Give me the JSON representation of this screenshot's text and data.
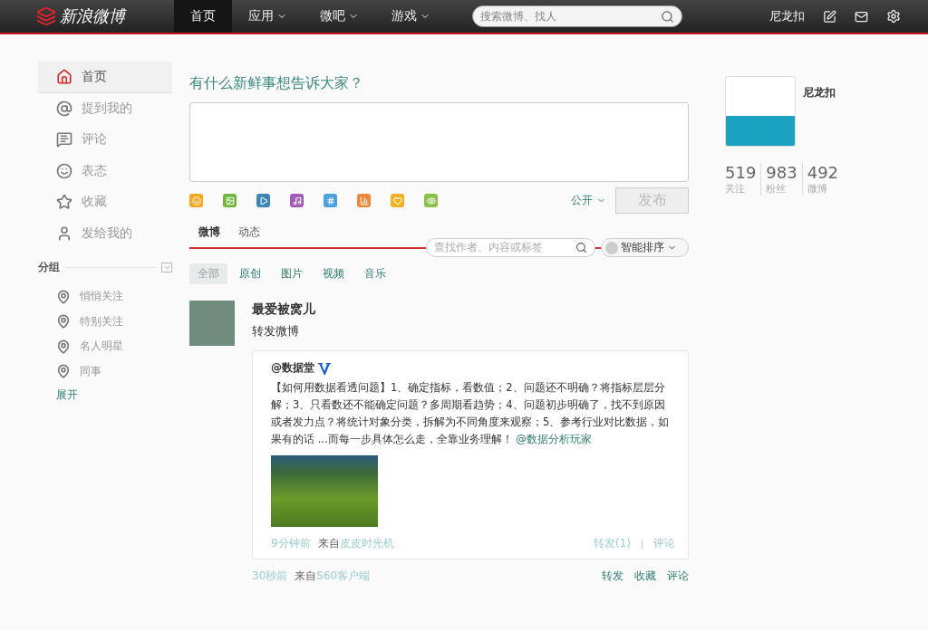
{
  "topbar": {
    "logo": "新浪微博",
    "tabs": [
      {
        "label": "首页",
        "selected": true,
        "dropdown": false
      },
      {
        "label": "应用",
        "selected": false,
        "dropdown": true
      },
      {
        "label": "微吧",
        "selected": false,
        "dropdown": true
      },
      {
        "label": "游戏",
        "selected": false,
        "dropdown": true
      }
    ],
    "search": {
      "placeholder": "搜索微博、找人"
    },
    "user": "尼龙扣"
  },
  "sidebar": {
    "items": [
      {
        "label": "首页",
        "kind": "home",
        "selected": true
      },
      {
        "label": "提到我的",
        "kind": "mention",
        "selected": false
      },
      {
        "label": "评论",
        "kind": "comment",
        "selected": false
      },
      {
        "label": "表态",
        "kind": "emote",
        "selected": false
      },
      {
        "label": "收藏",
        "kind": "star",
        "selected": false
      },
      {
        "label": "发给我的",
        "kind": "person",
        "selected": false
      }
    ],
    "group_heading": "分组",
    "groups": [
      "悄悄关注",
      "特别关注",
      "名人明星",
      "同事"
    ],
    "expand": "展开"
  },
  "composer": {
    "prompt": "有什么新鲜事想告诉大家？",
    "visibility": "公开",
    "submit": {
      "label": "发布",
      "disabled": true
    }
  },
  "feed": {
    "tabs": [
      {
        "label": "微博",
        "selected": true
      },
      {
        "label": "动态",
        "selected": false
      }
    ],
    "search": {
      "placeholder": "查找作者、内容或标签"
    },
    "sort": "智能排序",
    "filters": [
      {
        "label": "全部",
        "selected": true
      },
      {
        "label": "原创",
        "selected": false
      },
      {
        "label": "图片",
        "selected": false
      },
      {
        "label": "视频",
        "selected": false
      },
      {
        "label": "音乐",
        "selected": false
      }
    ],
    "posts": [
      {
        "author": "最爱被窝儿",
        "text": "转发微博",
        "repost": {
          "author": "@数据堂",
          "verified": true,
          "text": "【如何用数据看透问题】1、确定指标，看数值；2、问题还不明确？将指标层层分解；3、只看数还不能确定问题？多周期看趋势；4、问题初步明确了，找不到原因或者发力点？将统计对象分类，拆解为不同角度来观察；5、参考行业对比数据，如果有的话 ...而每一步具体怎么走，全靠业务理解！",
          "link": "@数据分析玩家",
          "time": "9分钟前",
          "source_prefix": "来自",
          "source": "皮皮时光机",
          "actions": [
            "转发(1)",
            "评论"
          ]
        },
        "time": "30秒前",
        "source_prefix": "来自",
        "source": "S60客户端",
        "actions": [
          "转发",
          "收藏",
          "评论"
        ]
      }
    ]
  },
  "profile": {
    "name": "尼龙扣",
    "stats": [
      {
        "value": "519",
        "label": "关注"
      },
      {
        "value": "983",
        "label": "粉丝"
      },
      {
        "value": "492",
        "label": "微博"
      }
    ]
  }
}
